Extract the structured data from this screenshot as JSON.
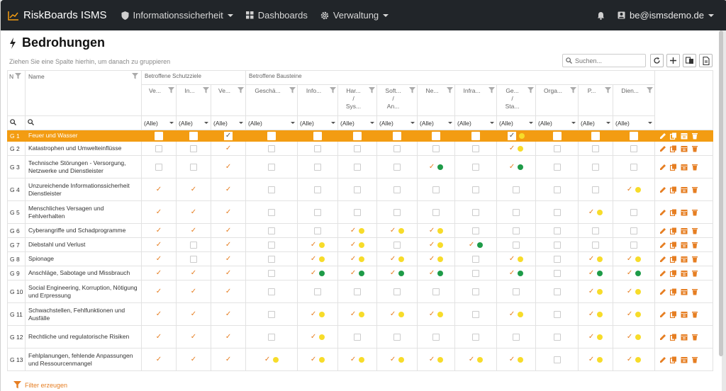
{
  "nav": {
    "brand": "RiskBoards ISMS",
    "items": [
      {
        "label": "Informationssicherheit",
        "icon": "shield-icon",
        "dropdown": true
      },
      {
        "label": "Dashboards",
        "icon": "dashboard-icon",
        "dropdown": false
      },
      {
        "label": "Verwaltung",
        "icon": "gear-icon",
        "dropdown": true
      }
    ],
    "user": "be@ismsdemo.de"
  },
  "page": {
    "title": "Bedrohungen",
    "group_hint": "Ziehen Sie eine Spalte hierhin, um danach zu gruppieren",
    "search_placeholder": "Suchen...",
    "footer_link": "Filter erzeugen"
  },
  "table": {
    "id_header": "N",
    "name_header": "Name",
    "groups": [
      {
        "label": "Betroffene Schutzziele"
      },
      {
        "label": "Betroffene Bausteine"
      }
    ],
    "columns": [
      [
        "Ve..."
      ],
      [
        "In..."
      ],
      [
        "Ve..."
      ],
      [
        "Geschä..."
      ],
      [
        "Info..."
      ],
      [
        "Har...",
        "/",
        "Sys..."
      ],
      [
        "Soft...",
        "/",
        "An..."
      ],
      [
        "Ne..."
      ],
      [
        "Infra..."
      ],
      [
        "Ge...",
        "/",
        "Sta..."
      ],
      [
        "Orga..."
      ],
      [
        "P..."
      ],
      [
        "Dien..."
      ]
    ],
    "filter_all": "(Alle)",
    "rows": [
      {
        "id": "G 1",
        "name": "Feuer und Wasser",
        "selected": true,
        "cells": [
          "cb",
          "cb",
          "chk",
          "cb",
          "cb",
          "cb",
          "cb",
          "cb",
          "cb",
          "chk-y",
          "cb",
          "cb",
          "cb"
        ]
      },
      {
        "id": "G 2",
        "name": "Katastrophen und Umwelteinflüsse",
        "cells": [
          "cb",
          "cb",
          "chk",
          "cb",
          "cb",
          "cb",
          "cb",
          "cb",
          "cb",
          "chk-y",
          "cb",
          "cb",
          "cb"
        ]
      },
      {
        "id": "G 3",
        "name": "Technische Störungen - Versorgung, Netzwerke und Dienstleister",
        "cells": [
          "cb",
          "cb",
          "chk",
          "cb",
          "cb",
          "cb",
          "cb",
          "chk-g",
          "cb",
          "chk-g",
          "cb",
          "cb",
          "cb"
        ]
      },
      {
        "id": "G 4",
        "name": "Unzureichende Informationssicherheit Dienstleister",
        "cells": [
          "chk",
          "chk",
          "chk",
          "cb",
          "cb",
          "cb",
          "cb",
          "cb",
          "cb",
          "cb",
          "cb",
          "cb",
          "chk-y"
        ]
      },
      {
        "id": "G 5",
        "name": "Menschliches Versagen und Fehlverhalten",
        "cells": [
          "chk",
          "chk",
          "chk",
          "cb",
          "cb",
          "cb",
          "cb",
          "cb",
          "cb",
          "cb",
          "cb",
          "chk-y",
          "cb"
        ]
      },
      {
        "id": "G 6",
        "name": "Cyberangriffe und Schadprogramme",
        "cells": [
          "chk",
          "chk",
          "chk",
          "cb",
          "cb",
          "chk-y",
          "chk-y",
          "chk-y",
          "cb",
          "cb",
          "cb",
          "cb",
          "cb"
        ]
      },
      {
        "id": "G 7",
        "name": "Diebstahl und Verlust",
        "cells": [
          "chk",
          "cb",
          "chk",
          "cb",
          "chk-y",
          "chk-y",
          "cb",
          "chk-y",
          "chk-g",
          "cb",
          "cb",
          "cb",
          "cb"
        ]
      },
      {
        "id": "G 8",
        "name": "Spionage",
        "cells": [
          "chk",
          "cb",
          "chk",
          "cb",
          "chk-y",
          "chk-y",
          "chk-y",
          "chk-y",
          "cb",
          "chk-y",
          "cb",
          "chk-y",
          "chk-y"
        ]
      },
      {
        "id": "G 9",
        "name": "Anschläge, Sabotage und Missbrauch",
        "cells": [
          "chk",
          "chk",
          "chk",
          "cb",
          "chk-g",
          "chk-g",
          "chk-g",
          "chk-g",
          "cb",
          "chk-g",
          "cb",
          "chk-g",
          "chk-g"
        ]
      },
      {
        "id": "G 10",
        "name": "Social Engineering, Korruption, Nötigung und Erpressung",
        "cells": [
          "chk",
          "chk",
          "chk",
          "cb",
          "cb",
          "cb",
          "cb",
          "cb",
          "cb",
          "cb",
          "cb",
          "chk-y",
          "chk-y"
        ]
      },
      {
        "id": "G 11",
        "name": "Schwachstellen, Fehlfunktionen und Ausfälle",
        "cells": [
          "chk",
          "chk",
          "chk",
          "cb",
          "chk-y",
          "chk-y",
          "chk-y",
          "chk-y",
          "cb",
          "chk-y",
          "cb",
          "chk-y",
          "chk-y"
        ]
      },
      {
        "id": "G 12",
        "name": "Rechtliche und regulatorische Risiken",
        "cells": [
          "chk",
          "chk",
          "chk",
          "cb",
          "chk-y",
          "cb",
          "cb",
          "cb",
          "cb",
          "cb",
          "cb",
          "chk-y",
          "chk-y"
        ]
      },
      {
        "id": "G 13",
        "name": "Fehlplanungen, fehlende Anpassungen und Ressourcenmangel",
        "cells": [
          "chk",
          "chk",
          "chk",
          "chk-y",
          "chk-y",
          "chk-y",
          "chk-y",
          "chk-y",
          "chk-y",
          "chk-y",
          "cb",
          "chk-y",
          "chk-y"
        ]
      }
    ]
  },
  "colors": {
    "accent": "#f39c12",
    "navbar": "#212529",
    "yellow": "#f7dc2a",
    "green": "#1e9b48"
  }
}
